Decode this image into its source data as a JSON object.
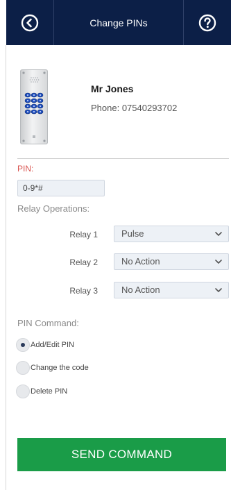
{
  "header": {
    "title": "Change PINs",
    "back_icon": "back-circle-icon",
    "help_icon": "help-circle-icon",
    "background_color": "#0c1f47"
  },
  "contact": {
    "name": "Mr Jones",
    "phone": "Phone: 07540293702",
    "image": "keypad-device-image"
  },
  "pin": {
    "label": "PIN:",
    "value": "0-9*#"
  },
  "relays": {
    "label": "Relay Operations:",
    "items": [
      {
        "label": "Relay 1",
        "value": "Pulse"
      },
      {
        "label": "Relay 2",
        "value": "No Action"
      },
      {
        "label": "Relay 3",
        "value": "No Action"
      }
    ]
  },
  "command": {
    "label": "PIN Command:",
    "options": [
      {
        "label": "Add/Edit PIN",
        "checked": true
      },
      {
        "label": "Change the code",
        "checked": false
      },
      {
        "label": "Delete PIN",
        "checked": false
      }
    ]
  },
  "send_button": {
    "label": "SEND COMMAND",
    "color": "#1a9c48"
  },
  "colors": {
    "pin_label": "#d9534f",
    "field_background": "#edf1f6"
  }
}
